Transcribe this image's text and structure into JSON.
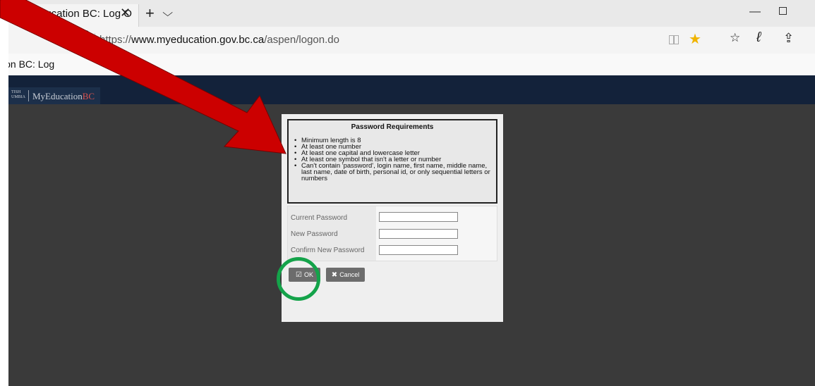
{
  "browser": {
    "tab_title": "MyEducation BC: Log O",
    "tab_close": "✕",
    "new_tab": "+",
    "tab_list": "⌵",
    "window_minimize": "—",
    "url_prefix": "https://",
    "url_domain": "www.myeducation.gov.bc.ca",
    "url_path": "/aspen/logon.do",
    "favorites_bar_item": "ion BC: Log",
    "icons": {
      "lock": "lock-icon",
      "reading_view": "reading-view-icon",
      "favorite": "star-icon",
      "favorites_hub": "favorites-icon",
      "notes": "pen-icon",
      "share": "share-icon"
    }
  },
  "site": {
    "logo_small": "TISH\nUMBIA",
    "logo_text": "MyEducation",
    "logo_text_bc": "BC"
  },
  "dialog": {
    "requirements_title": "Password Requirements",
    "requirements": [
      "Minimum length is 8",
      "At least one number",
      "At least one capital and lowercase letter",
      "At least one symbol that isn't a letter or number",
      "Can't contain 'password', login name, first name, middle name, last name, date of birth, personal id, or only sequential letters or numbers"
    ],
    "fields": {
      "current_password_label": "Current Password",
      "new_password_label": "New Password",
      "confirm_password_label": "Confirm New Password",
      "current_password_value": "",
      "new_password_value": "",
      "confirm_password_value": ""
    },
    "ok_label": "OK",
    "cancel_label": "Cancel"
  },
  "annotation": {
    "arrow_color": "#cc0000",
    "circle_color": "#14a34a"
  },
  "colors": {
    "header_bg": "#13223a",
    "page_bg": "#3a3a3a",
    "button_bg": "#6c6c6c",
    "star": "#f0b400"
  }
}
